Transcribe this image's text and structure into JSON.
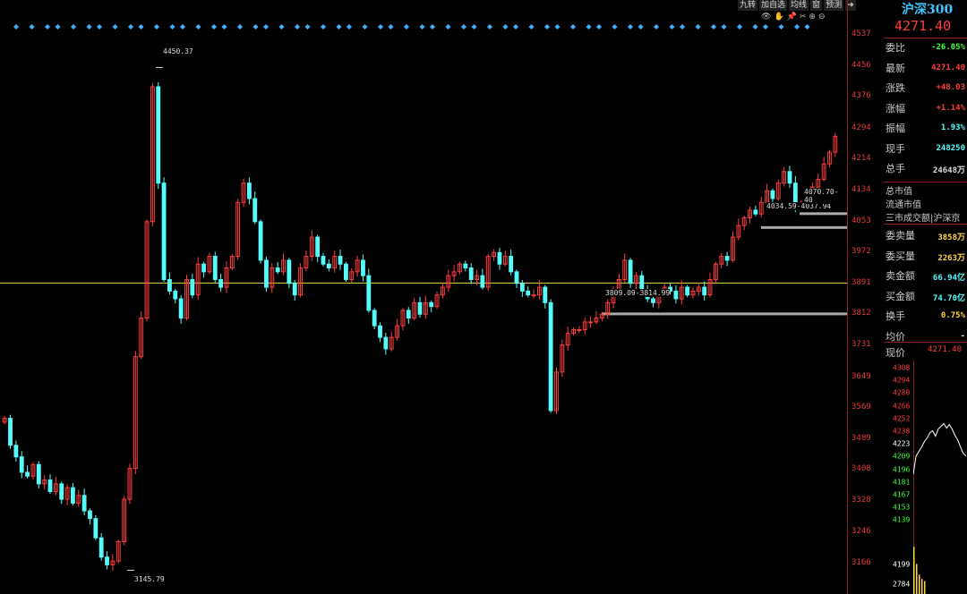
{
  "toolbar": {
    "items": [
      "九转",
      "加自选",
      "均线",
      "窗",
      "预测",
      "➔"
    ]
  },
  "tools": {
    "icons": [
      "eye-icon",
      "hand-icon",
      "pin-icon",
      "scissors-icon",
      "zoom-in-icon",
      "zoom-out-icon"
    ],
    "glyphs": [
      "👁",
      "✋",
      "📌",
      "✂",
      "⊕",
      "⊖"
    ]
  },
  "axis": {
    "ticks": [
      "4537",
      "4456",
      "4376",
      "4294",
      "4214",
      "4134",
      "4053",
      "3972",
      "3891",
      "3812",
      "3731",
      "3649",
      "3569",
      "3489",
      "3408",
      "3328",
      "3246",
      "3166"
    ]
  },
  "chart_data": {
    "type": "candlestick",
    "symbol": "沪深300",
    "ylim": [
      3140,
      4560
    ],
    "hline": 3891,
    "up_color": "#ff3d3d",
    "down_color": "#54fcfc",
    "annotations": {
      "high": "4450.37",
      "low": "3145.79",
      "gaps": [
        "3809.09-3814.99",
        "4034.59-4037.94",
        "4070.70-40"
      ]
    },
    "closes": [
      3540,
      3470,
      3440,
      3400,
      3390,
      3420,
      3370,
      3380,
      3350,
      3370,
      3330,
      3360,
      3320,
      3340,
      3300,
      3280,
      3230,
      3180,
      3160,
      3170,
      3220,
      3330,
      3410,
      3700,
      3800,
      4050,
      4400,
      4150,
      3900,
      3870,
      3850,
      3800,
      3900,
      3860,
      3940,
      3920,
      3960,
      3900,
      3880,
      3930,
      3960,
      4100,
      4150,
      4110,
      4050,
      3950,
      3880,
      3930,
      3920,
      3950,
      3890,
      3860,
      3930,
      3960,
      4010,
      3960,
      3940,
      3930,
      3960,
      3940,
      3900,
      3920,
      3950,
      3910,
      3820,
      3780,
      3750,
      3720,
      3750,
      3780,
      3820,
      3800,
      3840,
      3810,
      3840,
      3830,
      3860,
      3880,
      3910,
      3920,
      3940,
      3930,
      3900,
      3910,
      3880,
      3960,
      3970,
      3940,
      3960,
      3920,
      3890,
      3870,
      3860,
      3860,
      3880,
      3840,
      3560,
      3660,
      3730,
      3760,
      3770,
      3770,
      3790,
      3790,
      3800,
      3810,
      3840,
      3870,
      3900,
      3950,
      3890,
      3910,
      3870,
      3850,
      3840,
      3860,
      3880,
      3870,
      3850,
      3880,
      3860,
      3870,
      3880,
      3860,
      3900,
      3940,
      3960,
      3950,
      4010,
      4040,
      4060,
      4080,
      4070,
      4100,
      4130,
      4110,
      4150,
      4180,
      4150,
      4090,
      4100,
      4120,
      4140,
      4160,
      4200,
      4230,
      4271.4
    ]
  },
  "panel": {
    "title": "沪深300",
    "price": "4271.40",
    "rows": [
      {
        "label": "委比",
        "value": "-26.05%",
        "color": "#3dfc3d"
      },
      {
        "label": "最新",
        "value": "4271.40",
        "color": "#ff3d3d"
      },
      {
        "label": "涨跌",
        "value": "+48.03",
        "color": "#ff3d3d"
      },
      {
        "label": "涨幅",
        "value": "+1.14%",
        "color": "#ff3d3d"
      },
      {
        "label": "振幅",
        "value": "1.93%",
        "color": "#54fcfc"
      },
      {
        "label": "现手",
        "value": "248250",
        "color": "#54fcfc"
      },
      {
        "label": "总手",
        "value": "24648万",
        "color": "#dddddd"
      }
    ],
    "plain_rows": [
      "总市值",
      "流通市值",
      "三市成交额|沪深京"
    ],
    "rows2": [
      {
        "label": "委卖量",
        "value": "3858万",
        "color": "#ffd83d"
      },
      {
        "label": "委买量",
        "value": "2263万",
        "color": "#ffd83d"
      },
      {
        "label": "卖金额",
        "value": "66.94亿",
        "color": "#54fcfc"
      },
      {
        "label": "买金额",
        "value": "74.70亿",
        "color": "#54fcfc"
      },
      {
        "label": "换手",
        "value": "0.75%",
        "color": "#ffd83d"
      },
      {
        "label": "均价",
        "value": "-",
        "color": "#dddddd"
      }
    ],
    "current_label": "现价",
    "current_value": "4271.40",
    "mini_ticks": [
      "4308",
      "4294",
      "4280",
      "4266",
      "4252",
      "4238",
      "4223",
      "4209",
      "4196",
      "4181",
      "4167",
      "4153",
      "4139"
    ],
    "mini_volume_ticks": [
      "4199",
      "2784"
    ]
  }
}
